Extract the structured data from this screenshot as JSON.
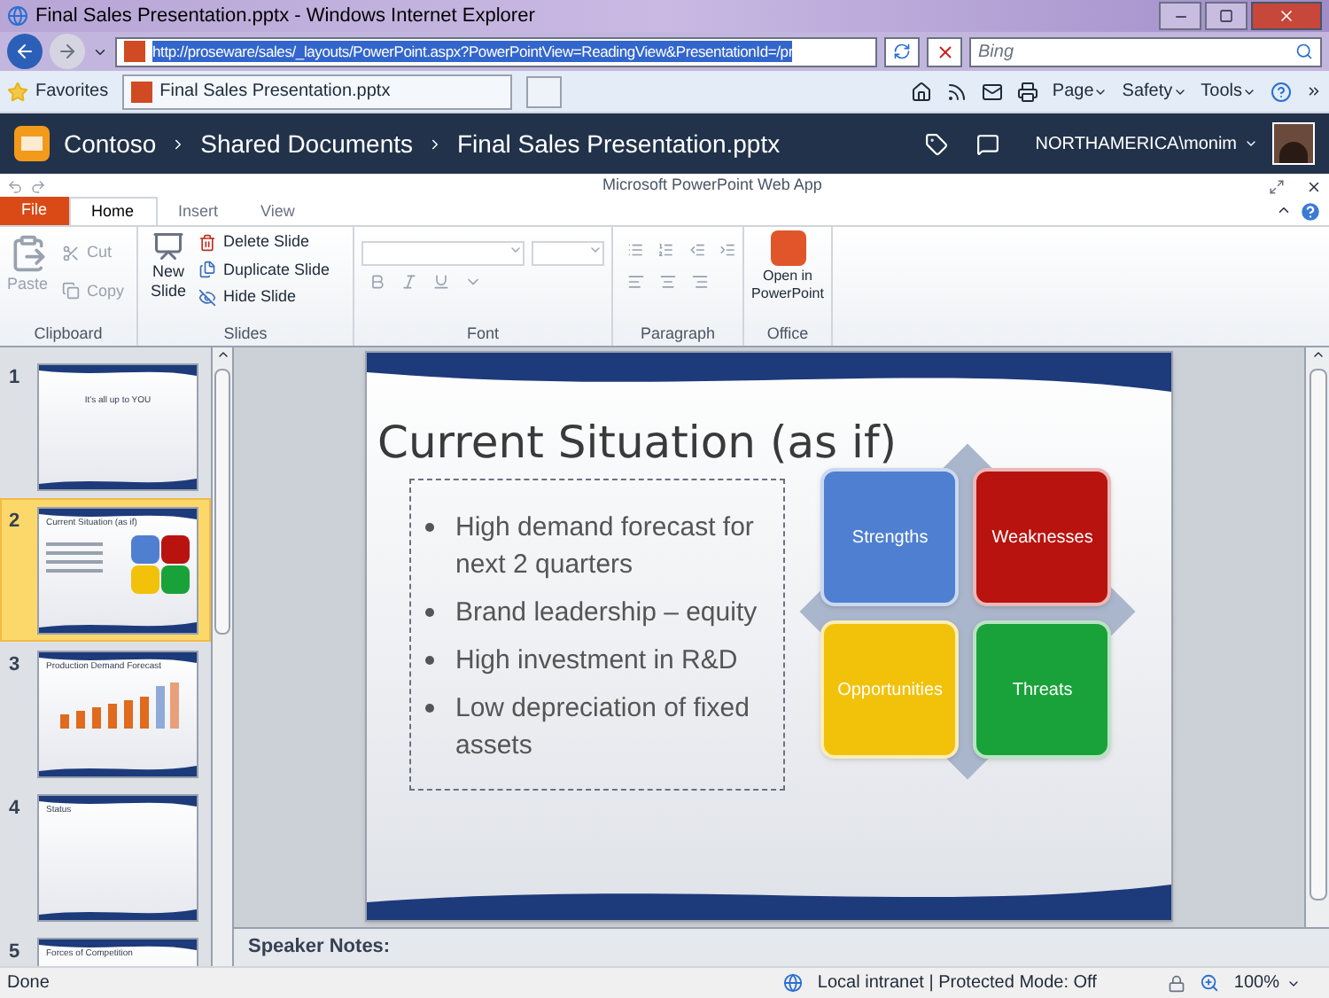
{
  "browser": {
    "title": "Final Sales Presentation.pptx - Windows Internet Explorer",
    "address": "http://proseware/sales/_layouts/PowerPoint.aspx?PowerPointView=ReadingView&PresentationId=/pr",
    "search_placeholder": "Bing"
  },
  "favorites": {
    "label": "Favorites",
    "tab": "Final Sales Presentation.pptx",
    "commands": [
      "Page",
      "Safety",
      "Tools"
    ]
  },
  "site": {
    "breadcrumbs": [
      "Contoso",
      "Shared Documents",
      "Final Sales Presentation.pptx"
    ],
    "user": "NORTHAMERICA\\monim"
  },
  "app_title": "Microsoft PowerPoint Web App",
  "tabs": [
    {
      "label": "File",
      "kind": "file",
      "selected": false
    },
    {
      "label": "Home",
      "kind": "tab",
      "selected": true
    },
    {
      "label": "Insert",
      "kind": "tab",
      "selected": false
    },
    {
      "label": "View",
      "kind": "tab",
      "selected": false
    }
  ],
  "ribbon": {
    "clipboard": {
      "label": "Clipboard",
      "paste": {
        "label": "Paste",
        "disabled": true
      },
      "cut": {
        "label": "Cut",
        "disabled": true
      },
      "copy": {
        "label": "Copy",
        "disabled": true
      }
    },
    "slides": {
      "label": "Slides",
      "new_slide": "New Slide",
      "delete": "Delete Slide",
      "duplicate": "Duplicate Slide",
      "hide": "Hide Slide"
    },
    "font": {
      "label": "Font"
    },
    "paragraph": {
      "label": "Paragraph"
    },
    "office": {
      "label": "Office",
      "open": "Open in PowerPoint"
    }
  },
  "thumbnails": [
    {
      "number": "1",
      "kind": "title",
      "title": "It's all up to YOU",
      "selected": false
    },
    {
      "number": "2",
      "kind": "swot",
      "title": "Current Situation (as if)",
      "selected": true
    },
    {
      "number": "3",
      "kind": "chart",
      "title": "Production Demand Forecast",
      "selected": false
    },
    {
      "number": "4",
      "kind": "plain",
      "title": "Status",
      "selected": false
    },
    {
      "number": "5",
      "kind": "forces",
      "title": "Forces of Competition",
      "selected": false
    }
  ],
  "slide": {
    "title": "Current Situation (as if)",
    "bullets": [
      "High demand forecast for next 2 quarters",
      "Brand leadership – equity",
      "High investment in R&D",
      "Low depreciation of fixed assets"
    ],
    "swot": [
      {
        "label": "Strengths",
        "color": "#4f7fd0"
      },
      {
        "label": "Weaknesses",
        "color": "#b8130e"
      },
      {
        "label": "Opportunities",
        "color": "#f2c10a"
      },
      {
        "label": "Threats",
        "color": "#1aa23a"
      }
    ]
  },
  "speaker_notes": {
    "label": "Speaker Notes:"
  },
  "status_bar": {
    "status": "Done",
    "zone": "Local intranet | Protected Mode: Off",
    "zoom": "100%"
  }
}
